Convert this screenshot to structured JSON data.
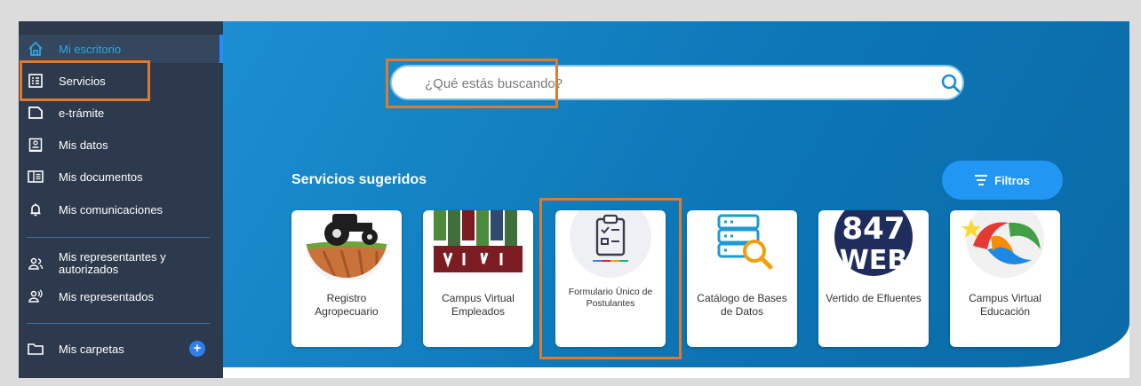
{
  "sidebar": {
    "items": [
      {
        "label": "Mi escritorio",
        "icon": "home-icon"
      },
      {
        "label": "Servicios",
        "icon": "list-icon"
      },
      {
        "label": "e-trámite",
        "icon": "document-icon"
      },
      {
        "label": "Mis datos",
        "icon": "id-card-icon"
      },
      {
        "label": "Mis documentos",
        "icon": "book-icon"
      },
      {
        "label": "Mis comunicaciones",
        "icon": "bell-icon"
      },
      {
        "label": "Mis representantes y autorizados",
        "icon": "people-icon"
      },
      {
        "label": "Mis representados",
        "icon": "person-voice-icon"
      },
      {
        "label": "Mis carpetas",
        "icon": "folder-icon"
      }
    ]
  },
  "search": {
    "placeholder": "¿Qué estás buscando?",
    "icon": "search-icon"
  },
  "services": {
    "title": "Servicios sugeridos",
    "filters_label": "Filtros",
    "cards": [
      {
        "label": "Registro Agropecuario"
      },
      {
        "label": "Campus Virtual Empleados"
      },
      {
        "label": "Formulario Único de Postulantes"
      },
      {
        "label": "Catálogo de Bases de Datos"
      },
      {
        "label": "Vertido de Efluentes",
        "thumb_text_1": "847",
        "thumb_text_2": "WEB"
      },
      {
        "label": "Campus Virtual Educación"
      }
    ]
  },
  "colors": {
    "sidebar": "#2d3a4d",
    "main": "#0f7fc0",
    "accent": "#2196f3",
    "highlight": "#e07a2c"
  }
}
